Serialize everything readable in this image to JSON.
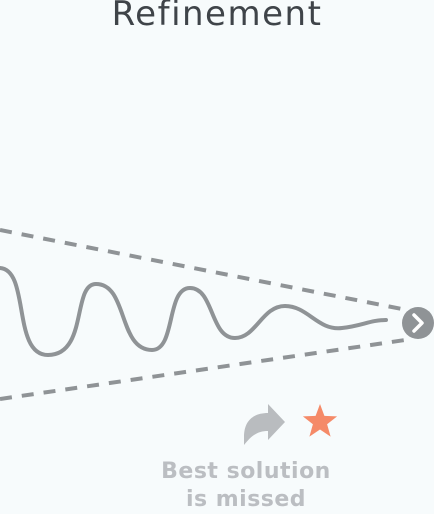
{
  "title": "Refinement",
  "caption": {
    "line1": "Best solution",
    "line2": "is missed"
  },
  "icons": {
    "arrow": "curved-arrow-icon",
    "star": "star-icon",
    "target": "chevron-right-circle-icon"
  },
  "colors": {
    "background": "#f7fbfc",
    "line": "#8f9396",
    "arrow": "#b9bcbf",
    "star": "#f58a68",
    "caption": "#bbbec2",
    "title": "#3f4449"
  }
}
